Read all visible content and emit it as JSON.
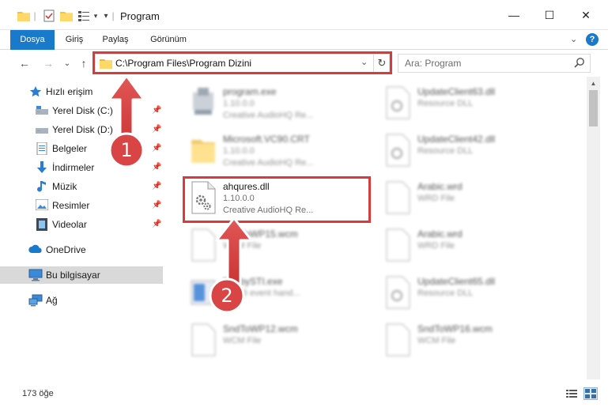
{
  "window": {
    "title": "Program",
    "minimize_glyph": "—",
    "maximize_glyph": "☐",
    "close_glyph": "✕"
  },
  "ribbon": {
    "tabs": [
      "Dosya",
      "Giriş",
      "Paylaş",
      "Görünüm"
    ],
    "help_glyph": "?",
    "collapse_glyph": "⌄"
  },
  "navigation": {
    "back_glyph": "←",
    "forward_glyph": "→",
    "recent_glyph": "⌄",
    "up_glyph": "↑",
    "address_path": "C:\\Program Files\\Program Dizini",
    "address_dropdown_glyph": "⌄",
    "refresh_glyph": "↻",
    "search_placeholder": "Ara: Program"
  },
  "sidebar": {
    "quick_access": "Hızlı erişim",
    "pinned_items": [
      {
        "label": "Yerel Disk (C:)",
        "icon": "drive-icon"
      },
      {
        "label": "Yerel Disk (D:)",
        "icon": "drive-icon"
      },
      {
        "label": "Belgeler",
        "icon": "documents-icon"
      },
      {
        "label": "İndirmeler",
        "icon": "downloads-icon"
      },
      {
        "label": "Müzik",
        "icon": "music-icon"
      },
      {
        "label": "Resimler",
        "icon": "pictures-icon"
      },
      {
        "label": "Videolar",
        "icon": "videos-icon"
      }
    ],
    "pin_glyph": "📌",
    "onedrive": "OneDrive",
    "this_pc": "Bu bilgisayar",
    "network": "Ağ"
  },
  "files": {
    "left_column": [
      {
        "name": "program.exe",
        "version": "1.10.0.0",
        "company": "Creative AudioHQ Re...",
        "icon": "exe-icon",
        "blurred": true
      },
      {
        "name": "Microsoft.VC90.CRT",
        "version": "1.10.0.0",
        "company": "Creative AudioHQ Re...",
        "icon": "folder-icon",
        "blurred": true
      },
      {
        "name": "ahqures.dll",
        "version": "1.10.0.0",
        "company": "Creative AudioHQ Re...",
        "icon": "dll-icon",
        "blurred": false
      },
      {
        "name": "SndToWP15.wcm",
        "version": "WCM File",
        "company": "",
        "icon": "file-icon",
        "blurred": true
      },
      {
        "name": "BabbySTI.exe",
        "version": "BY V6 event hand...",
        "company": "",
        "icon": "exe-icon",
        "blurred": true
      },
      {
        "name": "SndToWP12.wcm",
        "version": "WCM File",
        "company": "",
        "icon": "file-icon",
        "blurred": true
      }
    ],
    "right_column": [
      {
        "name": "UpdateClient63.dll",
        "version": "Resource DLL",
        "icon": "dll-icon"
      },
      {
        "name": "UpdateClient42.dll",
        "version": "Resource DLL",
        "icon": "dll-icon"
      },
      {
        "name": "Arabic.wrd",
        "version": "WRD File",
        "icon": "file-icon"
      },
      {
        "name": "Arabic.wrd",
        "version": "WRD File",
        "icon": "file-icon"
      },
      {
        "name": "UpdateClient65.dll",
        "version": "Resource DLL",
        "icon": "dll-icon"
      },
      {
        "name": "SndToWP16.wcm",
        "version": "WCM File",
        "icon": "file-icon"
      }
    ]
  },
  "status": {
    "item_count": "173 öğe"
  },
  "annotations": {
    "step1": "1",
    "step2": "2",
    "accent_color": "#d83b3b"
  }
}
